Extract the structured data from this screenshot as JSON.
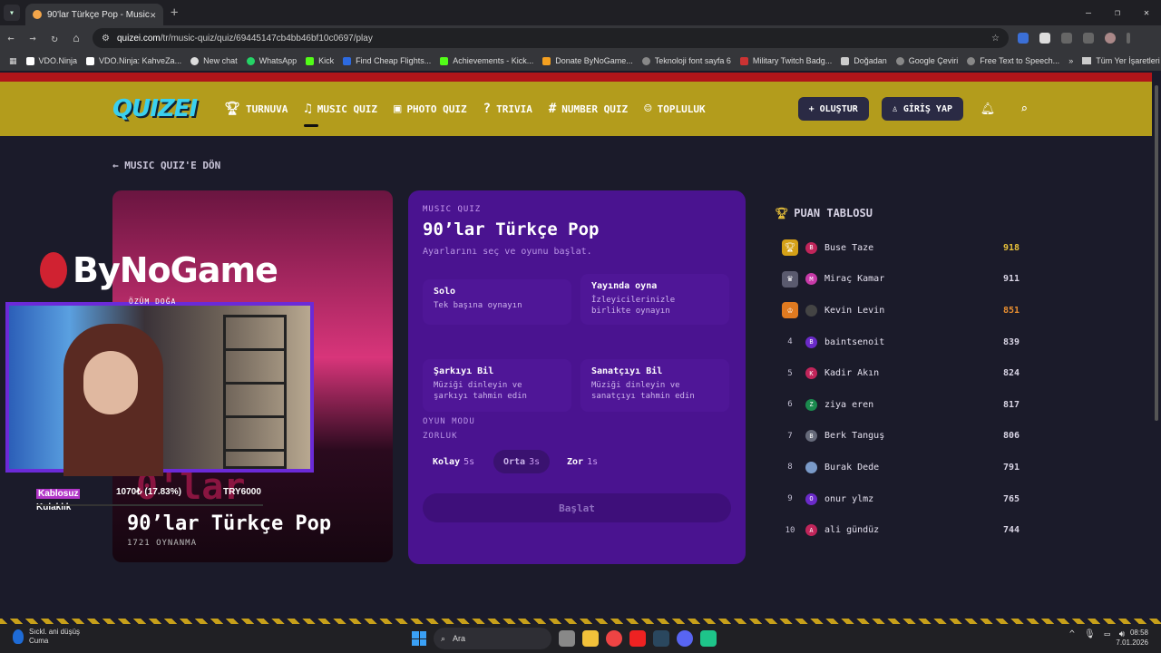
{
  "browser": {
    "tab_title": "90'lar Türkçe Pop - Music Quiz",
    "url_host": "quizei.com",
    "url_path": "/tr/music-quiz/quiz/69445147cb4bb46bf10c0697/play",
    "bookmarks": [
      "VDO.Ninja",
      "VDO.Ninja: KahveZa...",
      "New chat",
      "WhatsApp",
      "Kick",
      "Find Cheap Flights...",
      "Achievements - Kick...",
      "Donate ByNoGame...",
      "Teknoloji font sayfa 6",
      "Military Twitch Badg...",
      "Doğadan",
      "Google Çeviri",
      "Free Text to Speech..."
    ],
    "bookmarks_all": "Tüm Yer İşaretleri"
  },
  "site": {
    "logo": "QUIZEI",
    "nav": [
      "TURNUVA",
      "MUSIC QUIZ",
      "PHOTO QUIZ",
      "TRIVIA",
      "NUMBER QUIZ",
      "TOPLULUK"
    ],
    "create_label": "OLUŞTUR",
    "login_label": "GİRİŞ YAP",
    "back_label": "MUSIC QUIZ'E DÖN"
  },
  "cover": {
    "bg_text": "0'lar",
    "title": "90’lar Türkçe Pop",
    "plays": "1721 OYNANMA"
  },
  "panel": {
    "kicker": "MUSIC QUIZ",
    "title": "90’lar Türkçe Pop",
    "subtitle": "Ayarlarını seç ve oyunu başlat.",
    "play_options": [
      {
        "title": "Solo",
        "desc": "Tek başına oynayın"
      },
      {
        "title": "Yayında oyna",
        "desc": "İzleyicilerinizle birlikte oynayın"
      }
    ],
    "mode_label": "OYUN MODU",
    "modes": [
      {
        "title": "Şarkıyı Bil",
        "desc": "Müziği dinleyin ve şarkıyı tahmin edin"
      },
      {
        "title": "Sanatçıyı Bil",
        "desc": "Müziği dinleyin ve sanatçıyı tahmin edin"
      }
    ],
    "difficulty_label": "ZORLUK",
    "difficulties": [
      {
        "name": "Kolay",
        "time": "5s"
      },
      {
        "name": "Orta",
        "time": "3s"
      },
      {
        "name": "Zor",
        "time": "1s"
      }
    ],
    "start_label": "Başlat"
  },
  "leaderboard": {
    "title": "PUAN TABLOSU",
    "rows": [
      {
        "rank": "1",
        "initial": "B",
        "name": "Buse Taze",
        "score": "918",
        "avatar_color": "#c0255a"
      },
      {
        "rank": "2",
        "initial": "M",
        "name": "Miraç Kamar",
        "score": "911",
        "avatar_color": "#c83aa8"
      },
      {
        "rank": "3",
        "initial": "",
        "name": "Kevin Levin",
        "score": "851",
        "avatar_color": "#444"
      },
      {
        "rank": "4",
        "initial": "B",
        "name": "baintsenoit",
        "score": "839",
        "avatar_color": "#6a2ac8"
      },
      {
        "rank": "5",
        "initial": "K",
        "name": "Kadir Akın",
        "score": "824",
        "avatar_color": "#c0255a"
      },
      {
        "rank": "6",
        "initial": "Z",
        "name": "ziya eren",
        "score": "817",
        "avatar_color": "#1b8a4e"
      },
      {
        "rank": "7",
        "initial": "B",
        "name": "Berk Tanguş",
        "score": "806",
        "avatar_color": "#666a7a"
      },
      {
        "rank": "8",
        "initial": "",
        "name": "Burak Dede",
        "score": "791",
        "avatar_color": "#7a9ac8"
      },
      {
        "rank": "9",
        "initial": "O",
        "name": "onur ylmz",
        "score": "765",
        "avatar_color": "#6a2ac8"
      },
      {
        "rank": "10",
        "initial": "A",
        "name": "ali gündüz",
        "score": "744",
        "avatar_color": "#c0255a"
      }
    ]
  },
  "overlay": {
    "logo": "ByNoGame",
    "cam_name": "ÖZÜM DOĞA",
    "product_line1": "Kablosuz",
    "product_line2": "Kulaklık",
    "progress": "1070₺ (17.83%)",
    "goal": "TRY6000"
  },
  "taskbar": {
    "weather_line1": "Sıckl. ani düşüş",
    "weather_line2": "Cuma",
    "search": "Ara",
    "time": "08:58",
    "date": "7.01.2026"
  }
}
